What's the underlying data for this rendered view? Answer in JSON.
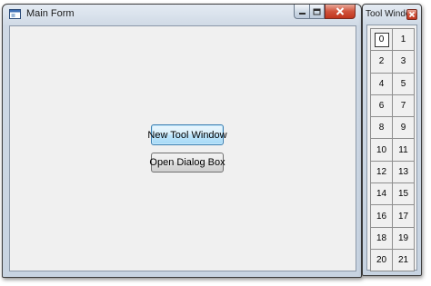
{
  "main_window": {
    "title": "Main Form",
    "icon": "form-window-icon",
    "caption_buttons": [
      "minimize-icon",
      "maximize-icon",
      "close-icon"
    ],
    "buttons": {
      "new_tool_window": "New Tool Window",
      "open_dialog": "Open Dialog Box"
    }
  },
  "tool_window": {
    "title": "Tool Window",
    "close_icon": "close-icon",
    "selected_index": 0,
    "cells": [
      "0",
      "1",
      "2",
      "3",
      "4",
      "5",
      "6",
      "7",
      "8",
      "9",
      "10",
      "11",
      "12",
      "13",
      "14",
      "15",
      "16",
      "17",
      "18",
      "19",
      "20",
      "21"
    ]
  },
  "colors": {
    "close_button": "#c0351e",
    "focused_button_border": "#3c7fb1",
    "client_background": "#f0f0f0"
  }
}
